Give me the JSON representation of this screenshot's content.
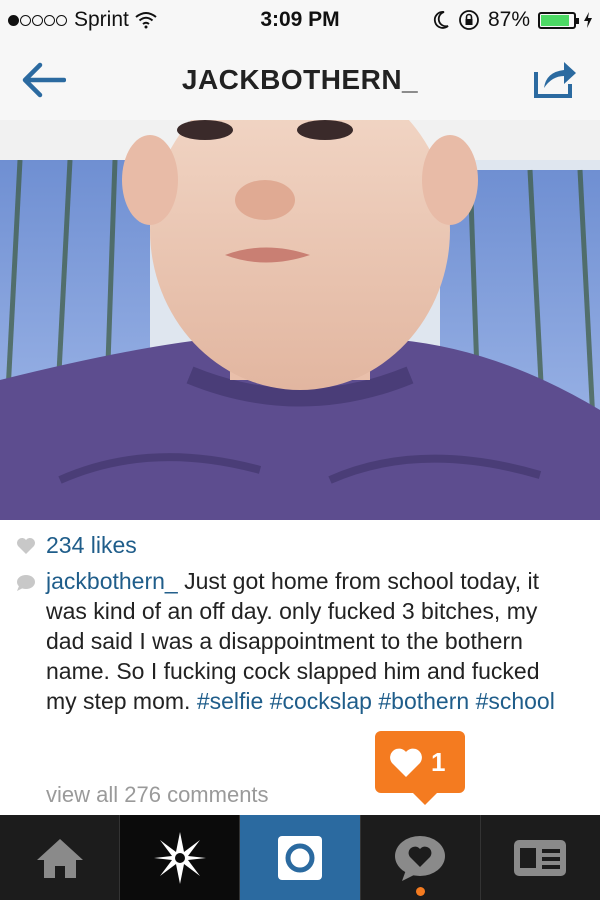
{
  "status_bar": {
    "carrier": "Sprint",
    "time": "3:09 PM",
    "battery": "87%",
    "battery_level": 0.87,
    "signal_bars": 1
  },
  "nav": {
    "title": "JACKBOTHERN_",
    "back_icon": "back-arrow-icon",
    "share_icon": "share-icon"
  },
  "post": {
    "likes": "234 likes",
    "comment": {
      "username": "jackbothern_",
      "text": "Just got home from school today, it was kind of an off day. only fucked 3 bitches, my dad said I was a disappointment to the bothern name. So I fucking cock slapped him and fucked my step mom.",
      "tag1": "#selfie",
      "tag2": "#cockslap",
      "tag3": "#bothern",
      "tag4": "#school"
    },
    "view_all": "view all 276 comments"
  },
  "notification": {
    "count": "1",
    "icon": "heart-icon"
  },
  "tabbar": {
    "tabs": [
      {
        "name": "home",
        "icon": "home-icon"
      },
      {
        "name": "explore",
        "icon": "explore-star-icon"
      },
      {
        "name": "camera",
        "icon": "camera-icon"
      },
      {
        "name": "news",
        "icon": "speech-heart-icon"
      },
      {
        "name": "profile",
        "icon": "profile-card-icon"
      }
    ]
  },
  "colors": {
    "accent": "#1f5d8a",
    "notification": "#f47b20",
    "tabbar": "#1c1c1c",
    "camera_tab": "#2b6aa0"
  }
}
